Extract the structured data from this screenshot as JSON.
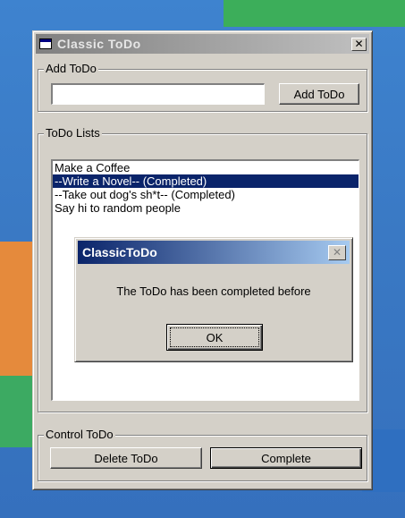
{
  "window": {
    "title": "Classic ToDo",
    "close_glyph": "✕"
  },
  "add_group": {
    "legend": "Add ToDo",
    "input_value": "",
    "add_button": "Add ToDo"
  },
  "lists_group": {
    "legend": "ToDo Lists",
    "items": [
      {
        "text": "Make a Coffee",
        "selected": false
      },
      {
        "text": "--Write a Novel-- (Completed)",
        "selected": true
      },
      {
        "text": "--Take out dog's sh*t-- (Completed)",
        "selected": false
      },
      {
        "text": "Say hi to random people",
        "selected": false
      }
    ]
  },
  "control_group": {
    "legend": "Control ToDo",
    "delete_button": "Delete ToDo",
    "complete_button": "Complete"
  },
  "dialog": {
    "title": "ClassicToDo",
    "message": "The ToDo has been completed before",
    "ok_button": "OK",
    "close_glyph": "✕"
  },
  "colors": {
    "titlebar_inactive": "#808080",
    "dialog_titlebar": "#0a246a",
    "selection": "#0a246a",
    "face": "#d4d0c8"
  }
}
